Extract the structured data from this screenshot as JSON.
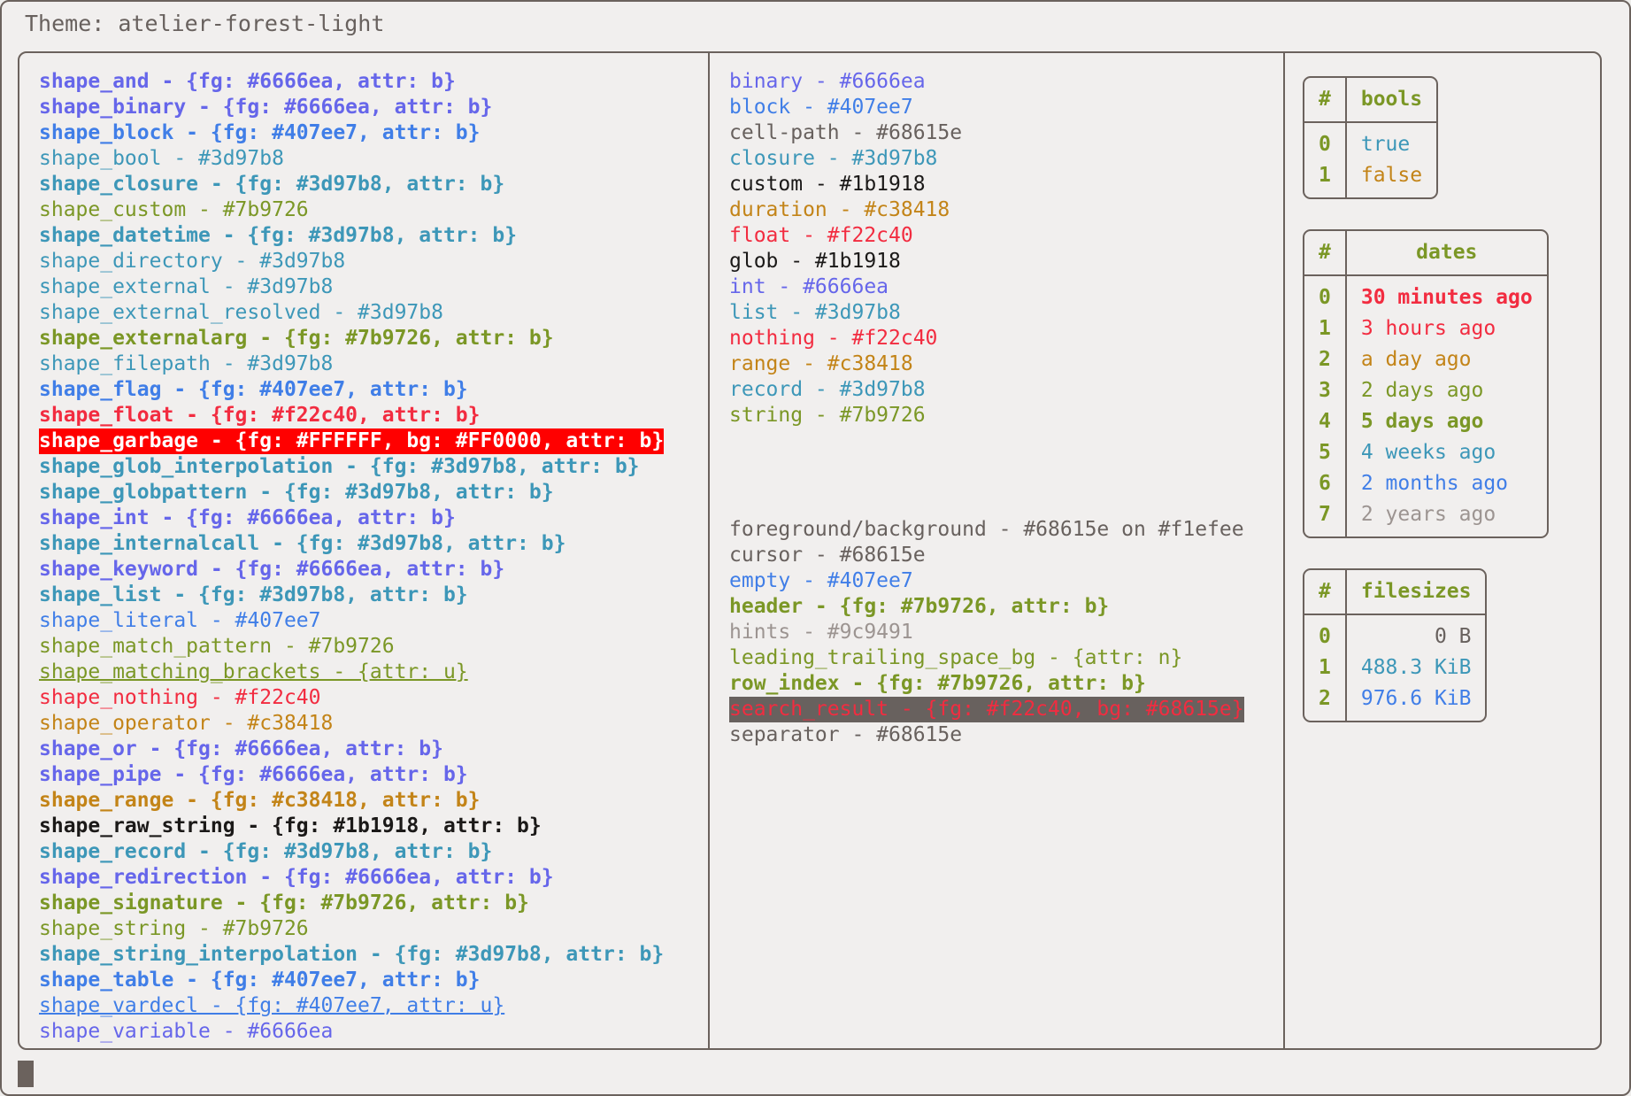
{
  "title": "Theme: atelier-forest-light",
  "palette": {
    "background": "#f1efee",
    "foreground": "#68615e",
    "border": "#6b625d",
    "purple": "#6666ea",
    "blue": "#407ee7",
    "cyan": "#3d97b8",
    "green": "#7b9726",
    "red": "#f22c40",
    "orange": "#c38418",
    "black": "#1b1918",
    "grey": "#9c9491",
    "garbage_fg": "#FFFFFF",
    "garbage_bg": "#FF0000",
    "search_result_fg": "#f22c40",
    "search_result_bg": "#68615e"
  },
  "columns": {
    "shapes": [
      {
        "text": "shape_and - {fg: #6666ea, attr: b}",
        "color": "#6666ea",
        "bold": true
      },
      {
        "text": "shape_binary - {fg: #6666ea, attr: b}",
        "color": "#6666ea",
        "bold": true
      },
      {
        "text": "shape_block - {fg: #407ee7, attr: b}",
        "color": "#407ee7",
        "bold": true
      },
      {
        "text": "shape_bool - #3d97b8",
        "color": "#3d97b8",
        "bold": false
      },
      {
        "text": "shape_closure - {fg: #3d97b8, attr: b}",
        "color": "#3d97b8",
        "bold": true
      },
      {
        "text": "shape_custom - #7b9726",
        "color": "#7b9726",
        "bold": false
      },
      {
        "text": "shape_datetime - {fg: #3d97b8, attr: b}",
        "color": "#3d97b8",
        "bold": true
      },
      {
        "text": "shape_directory - #3d97b8",
        "color": "#3d97b8",
        "bold": false
      },
      {
        "text": "shape_external - #3d97b8",
        "color": "#3d97b8",
        "bold": false
      },
      {
        "text": "shape_external_resolved - #3d97b8",
        "color": "#3d97b8",
        "bold": false
      },
      {
        "text": "shape_externalarg - {fg: #7b9726, attr: b}",
        "color": "#7b9726",
        "bold": true
      },
      {
        "text": "shape_filepath - #3d97b8",
        "color": "#3d97b8",
        "bold": false
      },
      {
        "text": "shape_flag - {fg: #407ee7, attr: b}",
        "color": "#407ee7",
        "bold": true
      },
      {
        "text": "shape_float - {fg: #f22c40, attr: b}",
        "color": "#f22c40",
        "bold": true
      },
      {
        "text": "shape_garbage - {fg: #FFFFFF, bg: #FF0000, attr: b}",
        "color": "#FFFFFF",
        "bg": "#FF0000",
        "bold": true
      },
      {
        "text": "shape_glob_interpolation - {fg: #3d97b8, attr: b}",
        "color": "#3d97b8",
        "bold": true
      },
      {
        "text": "shape_globpattern - {fg: #3d97b8, attr: b}",
        "color": "#3d97b8",
        "bold": true
      },
      {
        "text": "shape_int - {fg: #6666ea, attr: b}",
        "color": "#6666ea",
        "bold": true
      },
      {
        "text": "shape_internalcall - {fg: #3d97b8, attr: b}",
        "color": "#3d97b8",
        "bold": true
      },
      {
        "text": "shape_keyword - {fg: #6666ea, attr: b}",
        "color": "#6666ea",
        "bold": true
      },
      {
        "text": "shape_list - {fg: #3d97b8, attr: b}",
        "color": "#3d97b8",
        "bold": true
      },
      {
        "text": "shape_literal - #407ee7",
        "color": "#407ee7",
        "bold": false
      },
      {
        "text": "shape_match_pattern - #7b9726",
        "color": "#7b9726",
        "bold": false
      },
      {
        "text": "shape_matching_brackets - {attr: u}",
        "color": "#7b9726",
        "bold": false,
        "underline": true
      },
      {
        "text": "shape_nothing - #f22c40",
        "color": "#f22c40",
        "bold": false
      },
      {
        "text": "shape_operator - #c38418",
        "color": "#c38418",
        "bold": false
      },
      {
        "text": "shape_or - {fg: #6666ea, attr: b}",
        "color": "#6666ea",
        "bold": true
      },
      {
        "text": "shape_pipe - {fg: #6666ea, attr: b}",
        "color": "#6666ea",
        "bold": true
      },
      {
        "text": "shape_range - {fg: #c38418, attr: b}",
        "color": "#c38418",
        "bold": true
      },
      {
        "text": "shape_raw_string - {fg: #1b1918, attr: b}",
        "color": "#1b1918",
        "bold": true
      },
      {
        "text": "shape_record - {fg: #3d97b8, attr: b}",
        "color": "#3d97b8",
        "bold": true
      },
      {
        "text": "shape_redirection - {fg: #6666ea, attr: b}",
        "color": "#6666ea",
        "bold": true
      },
      {
        "text": "shape_signature - {fg: #7b9726, attr: b}",
        "color": "#7b9726",
        "bold": true
      },
      {
        "text": "shape_string - #7b9726",
        "color": "#7b9726",
        "bold": false
      },
      {
        "text": "shape_string_interpolation - {fg: #3d97b8, attr: b}",
        "color": "#3d97b8",
        "bold": true
      },
      {
        "text": "shape_table - {fg: #407ee7, attr: b}",
        "color": "#407ee7",
        "bold": true
      },
      {
        "text": "shape_vardecl - {fg: #407ee7, attr: u}",
        "color": "#407ee7",
        "bold": false,
        "underline": true
      },
      {
        "text": "shape_variable - #6666ea",
        "color": "#6666ea",
        "bold": false
      }
    ],
    "types": [
      {
        "text": "binary - #6666ea",
        "color": "#6666ea",
        "bold": false
      },
      {
        "text": "block - #407ee7",
        "color": "#407ee7",
        "bold": false
      },
      {
        "text": "cell-path - #68615e",
        "color": "#68615e",
        "bold": false
      },
      {
        "text": "closure - #3d97b8",
        "color": "#3d97b8",
        "bold": false
      },
      {
        "text": "custom - #1b1918",
        "color": "#1b1918",
        "bold": false
      },
      {
        "text": "duration - #c38418",
        "color": "#c38418",
        "bold": false
      },
      {
        "text": "float - #f22c40",
        "color": "#f22c40",
        "bold": false
      },
      {
        "text": "glob - #1b1918",
        "color": "#1b1918",
        "bold": false
      },
      {
        "text": "int - #6666ea",
        "color": "#6666ea",
        "bold": false
      },
      {
        "text": "list - #3d97b8",
        "color": "#3d97b8",
        "bold": false
      },
      {
        "text": "nothing - #f22c40",
        "color": "#f22c40",
        "bold": false
      },
      {
        "text": "range - #c38418",
        "color": "#c38418",
        "bold": false
      },
      {
        "text": "record - #3d97b8",
        "color": "#3d97b8",
        "bold": false
      },
      {
        "text": "string - #7b9726",
        "color": "#7b9726",
        "bold": false
      }
    ],
    "ui": [
      {
        "text": "foreground/background - #68615e on #f1efee",
        "color": "#68615e",
        "bold": false
      },
      {
        "text": "cursor - #68615e",
        "color": "#68615e",
        "bold": false
      },
      {
        "text": "empty - #407ee7",
        "color": "#407ee7",
        "bold": false
      },
      {
        "text": "header - {fg: #7b9726, attr: b}",
        "color": "#7b9726",
        "bold": true
      },
      {
        "text": "hints - #9c9491",
        "color": "#9c9491",
        "bold": false
      },
      {
        "text": "leading_trailing_space_bg - {attr: n}",
        "color": "#7b9726",
        "bold": false
      },
      {
        "text": "row_index - {fg: #7b9726, attr: b}",
        "color": "#7b9726",
        "bold": true
      },
      {
        "text": "search_result - {fg: #f22c40, bg: #68615e}",
        "color": "#f22c40",
        "bg": "#68615e",
        "bold": false
      },
      {
        "text": "separator - #68615e",
        "color": "#68615e",
        "bold": false
      }
    ]
  },
  "tables": [
    {
      "name": "bools",
      "index_header": "#",
      "value_header": "bools",
      "align": "left",
      "rows": [
        {
          "index": "0",
          "value": "true",
          "color": "#3d97b8",
          "bold": false
        },
        {
          "index": "1",
          "value": "false",
          "color": "#c38418",
          "bold": false
        }
      ]
    },
    {
      "name": "dates",
      "index_header": "#",
      "value_header": "dates",
      "align": "left",
      "rows": [
        {
          "index": "0",
          "value": "30 minutes ago",
          "color": "#f22c40",
          "bold": true
        },
        {
          "index": "1",
          "value": "3 hours ago",
          "color": "#f22c40",
          "bold": false
        },
        {
          "index": "2",
          "value": "a day ago",
          "color": "#c38418",
          "bold": false
        },
        {
          "index": "3",
          "value": "2 days ago",
          "color": "#7b9726",
          "bold": false
        },
        {
          "index": "4",
          "value": "5 days ago",
          "color": "#7b9726",
          "bold": true
        },
        {
          "index": "5",
          "value": "4 weeks ago",
          "color": "#3d97b8",
          "bold": false
        },
        {
          "index": "6",
          "value": "2 months ago",
          "color": "#407ee7",
          "bold": false
        },
        {
          "index": "7",
          "value": "2 years ago",
          "color": "#9c9491",
          "bold": false
        }
      ]
    },
    {
      "name": "filesizes",
      "index_header": "#",
      "value_header": "filesizes",
      "align": "right",
      "rows": [
        {
          "index": "0",
          "value": "0 B",
          "color": "#68615e",
          "bold": false
        },
        {
          "index": "1",
          "value": "488.3 KiB",
          "color": "#3d97b8",
          "bold": false
        },
        {
          "index": "2",
          "value": "976.6 KiB",
          "color": "#407ee7",
          "bold": false
        }
      ]
    }
  ]
}
